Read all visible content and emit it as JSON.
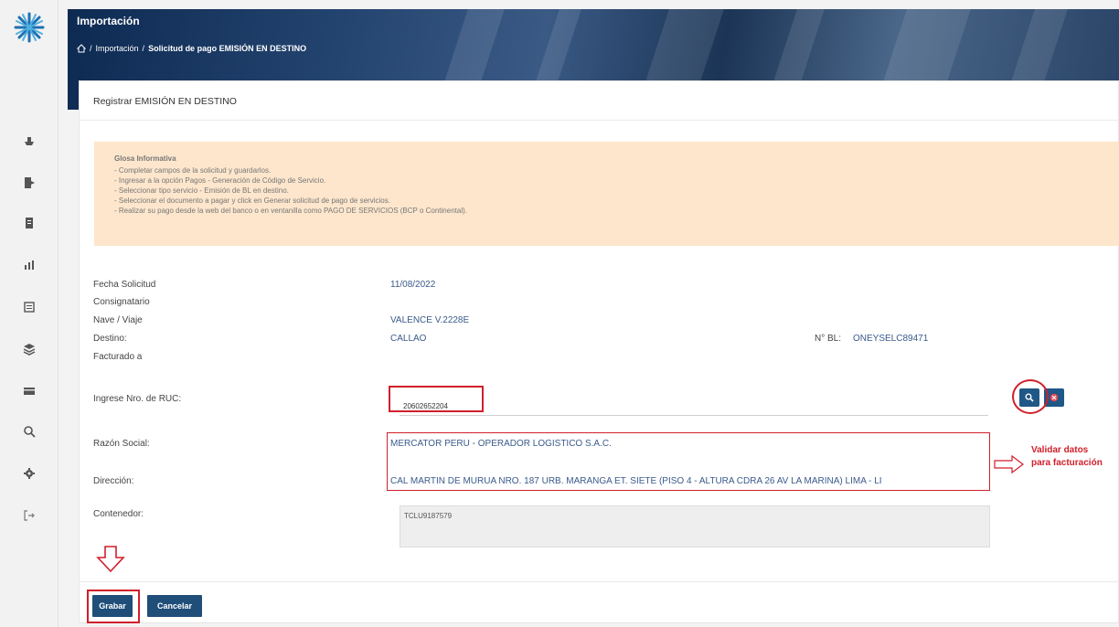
{
  "header": {
    "title": "Importación",
    "breadcrumb": [
      "Importación",
      "Solicitud de pago EMISIÓN EN DESTINO"
    ]
  },
  "card": {
    "title": "Registrar EMISIÓN EN DESTINO"
  },
  "info": {
    "title": "Glosa Informativa",
    "lines": [
      "- Completar campos de la solicitud y guardarlos.",
      "- Ingresar a la opción Pagos - Generación de Código de Servicio.",
      "- Seleccionar tipo servicio - Emisión de BL en destino.",
      "- Seleccionar el documento a pagar y click en Generar solicitud de pago de servicios.",
      "- Realizar su pago desde la web del banco o en ventanilla como PAGO DE SERVICIOS (BCP o Continental)."
    ]
  },
  "form": {
    "fecha_label": "Fecha Solicitud",
    "fecha_value": "11/08/2022",
    "consignatario_label": "Consignatario",
    "nave_label": "Nave / Viaje",
    "nave_value": "VALENCE V.2228E",
    "destino_label": "Destino:",
    "destino_value": "CALLAO",
    "bl_label": "N° BL:",
    "bl_value": "ONEYSELC89471",
    "facturado_label": "Facturado a",
    "ruc_label": "Ingrese Nro. de RUC:",
    "ruc_value": "20602652204",
    "razon_label": "Razón Social:",
    "razon_value": "MERCATOR PERU - OPERADOR LOGISTICO S.A.C.",
    "direccion_label": "Dirección:",
    "direccion_value": "CAL MARTIN DE MURUA NRO. 187 URB. MARANGA ET. SIETE (PISO 4 - ALTURA CDRA 26 AV LA MARINA) LIMA - LI",
    "contenedor_label": "Contenedor:",
    "contenedor_value": "TCLU9187579"
  },
  "annotation": {
    "line1": "Validar datos",
    "line2": "para facturación"
  },
  "buttons": {
    "grabar": "Grabar",
    "cancelar": "Cancelar"
  },
  "colors": {
    "primary": "#1f4e79",
    "highlight": "#d01f2a",
    "info_bg": "#fde6cc"
  },
  "icons": [
    "logo-star-icon",
    "ship-icon",
    "document-export-icon",
    "file-icon",
    "chart-icon",
    "list-icon",
    "layers-icon",
    "card-icon",
    "search-icon",
    "gear-icon",
    "logout-icon",
    "home-icon",
    "search-icon",
    "clear-icon"
  ]
}
